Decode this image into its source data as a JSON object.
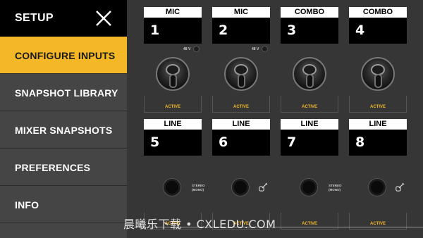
{
  "sidebar": {
    "title": "SETUP",
    "items": [
      {
        "label": "CONFIGURE INPUTS",
        "active": true
      },
      {
        "label": "SNAPSHOT LIBRARY",
        "active": false
      },
      {
        "label": "MIXER SNAPSHOTS",
        "active": false
      },
      {
        "label": "PREFERENCES",
        "active": false
      },
      {
        "label": "INFO",
        "active": false
      }
    ]
  },
  "channels_top": [
    {
      "type": "MIC",
      "number": "1",
      "phantom": "48 V",
      "status": "ACTIVE"
    },
    {
      "type": "MIC",
      "number": "2",
      "phantom": "48 V",
      "status": "ACTIVE"
    },
    {
      "type": "COMBO",
      "number": "3",
      "status": "ACTIVE"
    },
    {
      "type": "COMBO",
      "number": "4",
      "status": "ACTIVE"
    }
  ],
  "channels_bottom": [
    {
      "type": "LINE",
      "number": "5",
      "mode_a": "STEREO",
      "mode_b": "(MONO)",
      "status": "ACTIVE"
    },
    {
      "type": "LINE",
      "number": "6",
      "icon": "guitar-icon",
      "status": "ACTIVE"
    },
    {
      "type": "LINE",
      "number": "7",
      "mode_a": "STEREO",
      "mode_b": "(MONO)",
      "status": "ACTIVE"
    },
    {
      "type": "LINE",
      "number": "8",
      "icon": "guitar-icon",
      "status": "ACTIVE"
    }
  ],
  "watermark": "晨曦乐下载 • CXLEDU.COM",
  "colors": {
    "accent": "#f3b728",
    "sidebar": "#454545",
    "main": "#363636"
  }
}
